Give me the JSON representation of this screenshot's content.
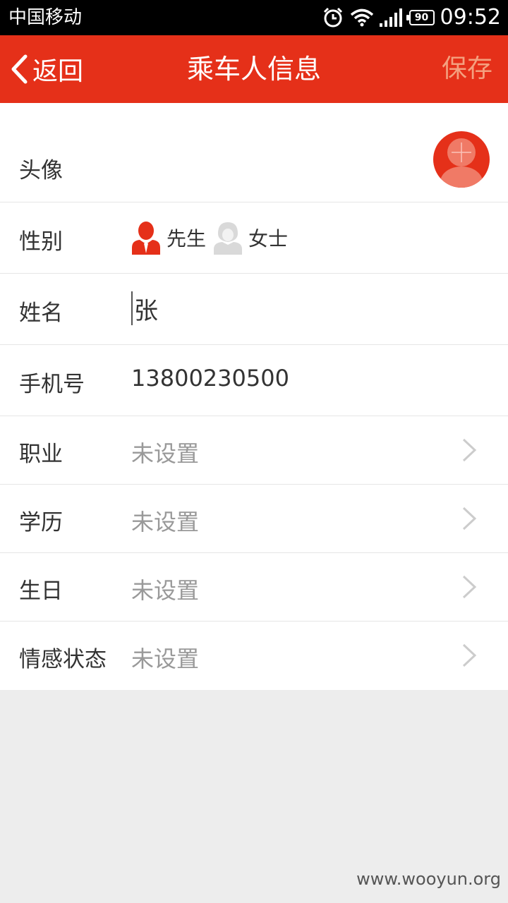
{
  "status_bar": {
    "carrier": "中国移动",
    "battery": "90",
    "time": "09:52"
  },
  "nav": {
    "back_label": "返回",
    "title": "乘车人信息",
    "save_label": "保存"
  },
  "form": {
    "avatar_label": "头像",
    "gender": {
      "label": "性别",
      "options": [
        "先生",
        "女士"
      ],
      "selected": "先生"
    },
    "name": {
      "label": "姓名",
      "value": "张"
    },
    "phone": {
      "label": "手机号",
      "value": "13800230500"
    },
    "occupation": {
      "label": "职业",
      "value": "未设置"
    },
    "education": {
      "label": "学历",
      "value": "未设置"
    },
    "birthday": {
      "label": "生日",
      "value": "未设置"
    },
    "relationship": {
      "label": "情感状态",
      "value": "未设置"
    }
  },
  "watermark": "www.wooyun.org",
  "colors": {
    "accent": "#e53019",
    "save_text": "#f4a07f",
    "background": "#ededed",
    "placeholder": "#999999"
  },
  "icons": [
    "alarm-icon",
    "wifi-icon",
    "signal-icon",
    "battery-icon",
    "back-chevron-icon",
    "male-icon",
    "female-icon",
    "chevron-right-icon"
  ]
}
